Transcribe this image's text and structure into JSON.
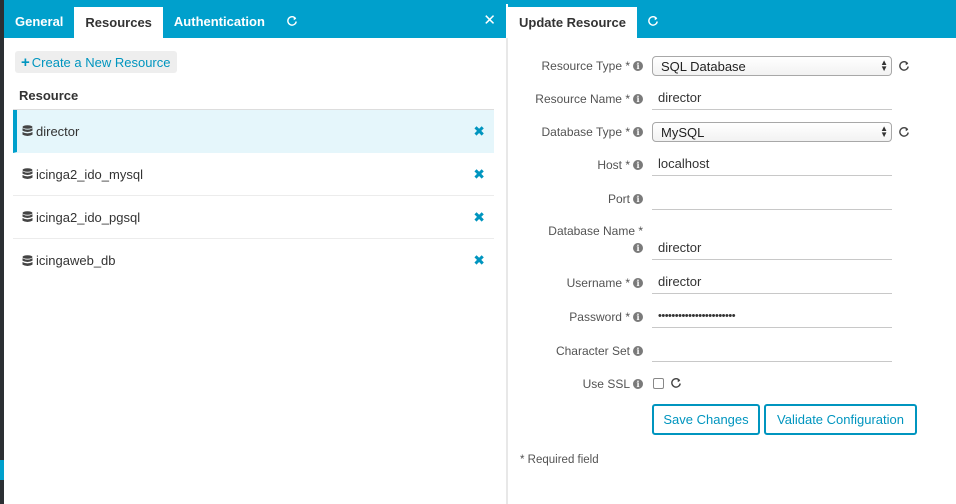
{
  "left_tabs": [
    {
      "label": "General",
      "active": false
    },
    {
      "label": "Resources",
      "active": true
    },
    {
      "label": "Authentication",
      "active": false
    }
  ],
  "right_tabs": [
    {
      "label": "Update Resource",
      "active": true
    }
  ],
  "left_pane": {
    "create_label": "Create a New Resource",
    "list_header": "Resource",
    "resources": [
      {
        "name": "director",
        "selected": true
      },
      {
        "name": "icinga2_ido_mysql",
        "selected": false
      },
      {
        "name": "icinga2_ido_pgsql",
        "selected": false
      },
      {
        "name": "icingaweb_db",
        "selected": false
      }
    ]
  },
  "form": {
    "resource_type": {
      "label": "Resource Type *",
      "value": "SQL Database"
    },
    "resource_name": {
      "label": "Resource Name *",
      "value": "director"
    },
    "database_type": {
      "label": "Database Type *",
      "value": "MySQL"
    },
    "host": {
      "label": "Host *",
      "value": "localhost"
    },
    "port": {
      "label": "Port",
      "value": ""
    },
    "database_name": {
      "label": "Database Name *",
      "value": "director"
    },
    "username": {
      "label": "Username *",
      "value": "director"
    },
    "password": {
      "label": "Password *",
      "value": "•••••••••••••••••••••••"
    },
    "character_set": {
      "label": "Character Set",
      "value": ""
    },
    "use_ssl": {
      "label": "Use SSL",
      "checked": false
    },
    "save_label": "Save Changes",
    "validate_label": "Validate Configuration",
    "required_note": "* Required field"
  },
  "colors": {
    "accent": "#00a0cc",
    "link": "#0095bf",
    "selected_row": "#e5f6fb"
  }
}
